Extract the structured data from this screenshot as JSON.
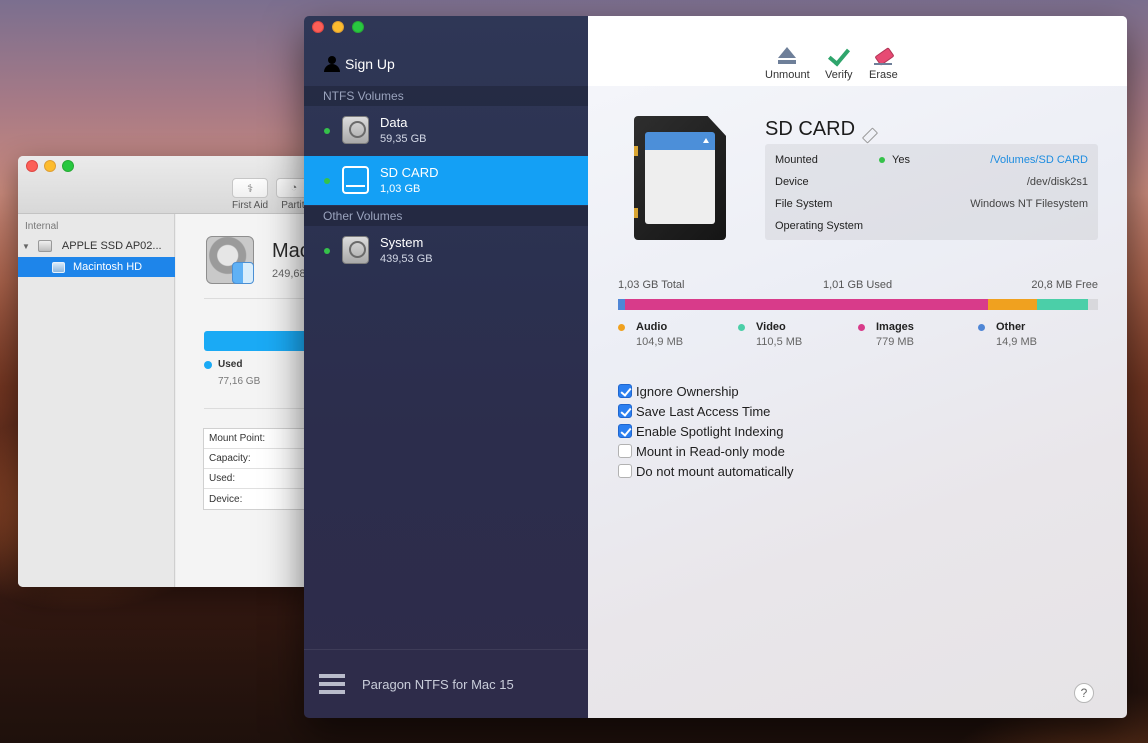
{
  "disk_utility": {
    "toolbar": [
      {
        "label": "First Aid",
        "icon": "stethoscope-icon"
      },
      {
        "label": "Partiti",
        "icon": "partition-icon"
      }
    ],
    "sidebar": {
      "section": "Internal",
      "disk": "APPLE SSD AP02...",
      "volume": "Macintosh HD"
    },
    "main": {
      "name": "Mac",
      "size": "249,68",
      "used_label": "Used",
      "used_value": "77,16 GB",
      "fields": [
        "Mount Point:",
        "Capacity:",
        "Used:",
        "Device:"
      ]
    }
  },
  "paragon": {
    "sidebar": {
      "sign_up": "Sign Up",
      "sections": {
        "ntfs": "NTFS Volumes",
        "other": "Other Volumes"
      },
      "volumes": [
        {
          "name": "Data",
          "size": "59,35 GB",
          "status_color": "#35c24a"
        },
        {
          "name": "SD CARD",
          "size": "1,03 GB",
          "status_color": "#35c24a",
          "selected": true
        },
        {
          "name": "System",
          "size": "439,53 GB",
          "status_color": "#35c24a"
        }
      ],
      "footer": "Paragon NTFS for Mac 15"
    },
    "toolbar": {
      "unmount": "Unmount",
      "verify": "Verify",
      "erase": "Erase"
    },
    "volume": {
      "title": "SD CARD",
      "info": {
        "mounted_label": "Mounted",
        "mounted_state": "Yes",
        "mounted_path": "/Volumes/SD CARD",
        "device_label": "Device",
        "device_value": "/dev/disk2s1",
        "fs_label": "File System",
        "fs_value": "Windows NT Filesystem",
        "os_label": "Operating System",
        "os_value": ""
      },
      "usage": {
        "total": "1,03 GB Total",
        "used": "1,01 GB Used",
        "free": "20,8 MB Free",
        "segments": [
          {
            "name": "Other",
            "size": "14,9 MB",
            "color": "#4f86d6",
            "percent": 1.4
          },
          {
            "name": "Images",
            "size": "779 MB",
            "color": "#d83b8a",
            "percent": 75.6
          },
          {
            "name": "Audio",
            "size": "104,9 MB",
            "color": "#f0a11f",
            "percent": 10.2
          },
          {
            "name": "Video",
            "size": "110,5 MB",
            "color": "#4bcfa8",
            "percent": 10.7
          }
        ],
        "legend_order": [
          "Audio",
          "Video",
          "Images",
          "Other"
        ]
      },
      "options": [
        {
          "label": "Ignore Ownership",
          "checked": true
        },
        {
          "label": "Save Last Access Time",
          "checked": true
        },
        {
          "label": "Enable Spotlight Indexing",
          "checked": true
        },
        {
          "label": "Mount in Read-only mode",
          "checked": false
        },
        {
          "label": "Do not mount automatically",
          "checked": false
        }
      ]
    },
    "help": "?"
  }
}
